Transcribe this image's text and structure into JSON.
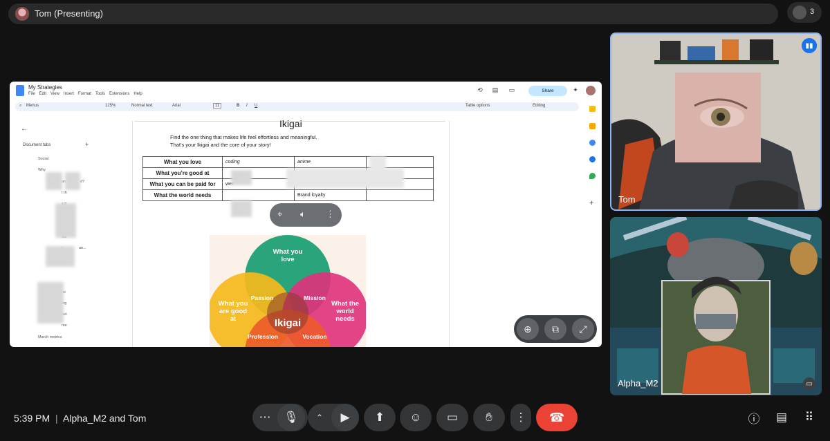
{
  "topbar": {
    "presenter_label": "Tom (Presenting)",
    "participant_count": "3"
  },
  "doc": {
    "title": "My Strategies",
    "menu": [
      "File",
      "Edit",
      "View",
      "Insert",
      "Format",
      "Tools",
      "Extensions",
      "Help"
    ],
    "share_label": "Share",
    "toolbar": {
      "menus": "Menus",
      "zoom": "125%",
      "style": "Normal text",
      "font": "Arial",
      "font_size": "11",
      "table_options": "Table options",
      "mode": "Editing"
    },
    "sidebar": {
      "tabs_label": "Document tabs",
      "outline": [
        "Social",
        "Why",
        "an",
        "d?",
        "t th",
        "s it",
        "iabl",
        "pac",
        "our",
        "r",
        "an...",
        "ne",
        "ing",
        "net",
        "me"
      ],
      "last_item": "March metrics"
    },
    "heading": "Ikigai",
    "intro_line1": "Find the one thing that makes life feel effortless and meaningful.",
    "intro_line2": "That's your Ikigai and the core of your story!",
    "table": [
      {
        "label": "What you love",
        "c1": "coding",
        "c2": "anime"
      },
      {
        "label": "What you’re good at",
        "c1": "",
        "c2": ""
      },
      {
        "label": "What you can be paid for",
        "c1": "wer",
        "c2": ""
      },
      {
        "label": "What the world needs",
        "c1": "",
        "c2": "Brand loyalty"
      }
    ],
    "venn": {
      "love": "What you love",
      "good": "What you are good at",
      "world": "What the world needs",
      "passion": "Passion",
      "mission": "Mission",
      "center": "Ikigai",
      "profession": "Profession",
      "vocation": "Vocation"
    }
  },
  "tiles": {
    "tom_name": "Tom",
    "alpha_name": "Alpha_M2"
  },
  "bottom": {
    "time": "5:39 PM",
    "separator": "|",
    "meeting_title": "Alpha_M2 and Tom"
  },
  "colors": {
    "background": "#121212",
    "control": "#333537",
    "end_call": "#ea4335",
    "accent": "#8ab4f8",
    "venn_love": "#2aa57b",
    "venn_good": "#f5b91b",
    "venn_world": "#e0317b",
    "venn_bottom": "#ec5a2b"
  }
}
